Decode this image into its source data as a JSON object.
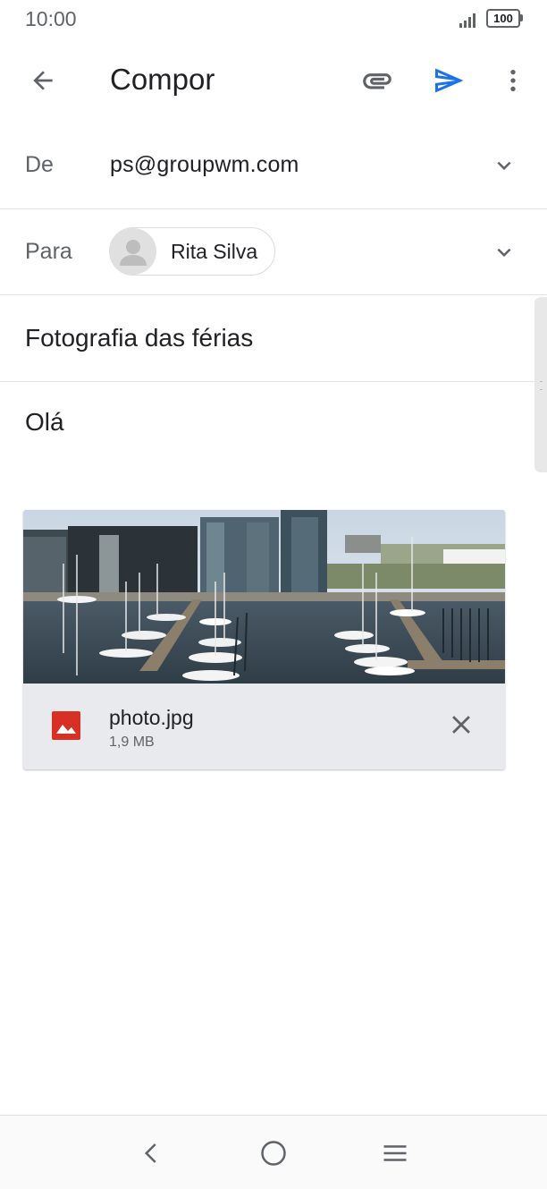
{
  "status_bar": {
    "time": "10:00",
    "battery": "100"
  },
  "toolbar": {
    "title": "Compor",
    "accent_color": "#1a73e8"
  },
  "from": {
    "label": "De",
    "value": "ps@groupwm.com"
  },
  "to": {
    "label": "Para",
    "recipient": "Rita Silva"
  },
  "subject": "Fotografia das férias",
  "body": "Olá",
  "attachment": {
    "name": "photo.jpg",
    "size": "1,9 MB",
    "icon_color": "#d93025"
  }
}
